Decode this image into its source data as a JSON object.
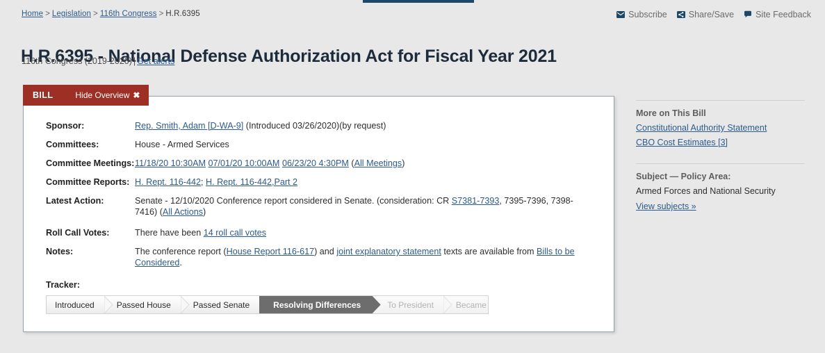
{
  "breadcrumb": {
    "items": [
      {
        "label": "Home",
        "link": true
      },
      {
        "label": "Legislation",
        "link": true
      },
      {
        "label": "116th Congress",
        "link": true
      },
      {
        "label": "H.R.6395",
        "link": false
      }
    ],
    "separator": ">"
  },
  "utility": {
    "subscribe": "Subscribe",
    "share": "Share/Save",
    "feedback": "Site Feedback"
  },
  "header": {
    "title": "H.R.6395 - National Defense Authorization Act for Fiscal Year 2021",
    "congress": "116th Congress (2019-2020)",
    "divider": "|",
    "get_alerts": "Get alerts"
  },
  "card": {
    "tab_label": "BILL",
    "hide_overview": "Hide Overview",
    "close_glyph": "✖",
    "accent_color": "#9d2f24",
    "fields": {
      "sponsor_label": "Sponsor:",
      "sponsor_link": "Rep. Smith, Adam [D-WA-9]",
      "sponsor_rest": " (Introduced 03/26/2020)(by request)",
      "committees_label": "Committees:",
      "committees_value": "House - Armed Services",
      "meetings_label": "Committee Meetings:",
      "meetings": [
        "11/18/20 10:30AM",
        "07/01/20 10:00AM",
        "06/23/20 4:30PM"
      ],
      "meetings_all_open": "(",
      "meetings_all": "All Meetings",
      "meetings_all_close": ")",
      "reports_label": "Committee Reports:",
      "report_1": "H. Rept. 116-442",
      "report_sep": "; ",
      "report_2": "H. Rept. 116-442,Part 2",
      "latest_label": "Latest Action:",
      "latest_pre": "Senate - 12/10/2020 Conference report considered in Senate. (consideration: CR ",
      "latest_link": "S7381-7393",
      "latest_mid": ", 7395-7396, 7398-7416) ",
      "latest_all_open": "(",
      "latest_all_actions": "All Actions",
      "latest_all_close": ")",
      "rollcall_label": "Roll Call Votes:",
      "rollcall_pre": "There have been ",
      "rollcall_link": "14 roll call votes",
      "notes_label": "Notes:",
      "notes_p1": "The conference report (",
      "notes_link1": "House Report 116-617",
      "notes_p2": ") and ",
      "notes_link2": "joint explanatory statement",
      "notes_p3": " texts are available from ",
      "notes_link3": "Bills to be Considered",
      "notes_p4": "."
    },
    "tracker": {
      "title": "Tracker:",
      "steps": [
        {
          "label": "Introduced",
          "state": "done"
        },
        {
          "label": "Passed House",
          "state": "done"
        },
        {
          "label": "Passed Senate",
          "state": "done"
        },
        {
          "label": "Resolving Differences",
          "state": "active"
        },
        {
          "label": "To President",
          "state": "future"
        },
        {
          "label": "Became Law",
          "state": "future"
        }
      ],
      "active_color": "#6d6d6d"
    }
  },
  "sidebar": {
    "more_heading": "More on This Bill",
    "more_links": [
      {
        "label": "Constitutional Authority Statement",
        "count": ""
      },
      {
        "label": "CBO Cost Estimates ",
        "count": "[3]"
      }
    ],
    "subject_heading": "Subject — Policy Area:",
    "subject_value": "Armed Forces and National Security",
    "view_subjects": "View subjects »"
  }
}
